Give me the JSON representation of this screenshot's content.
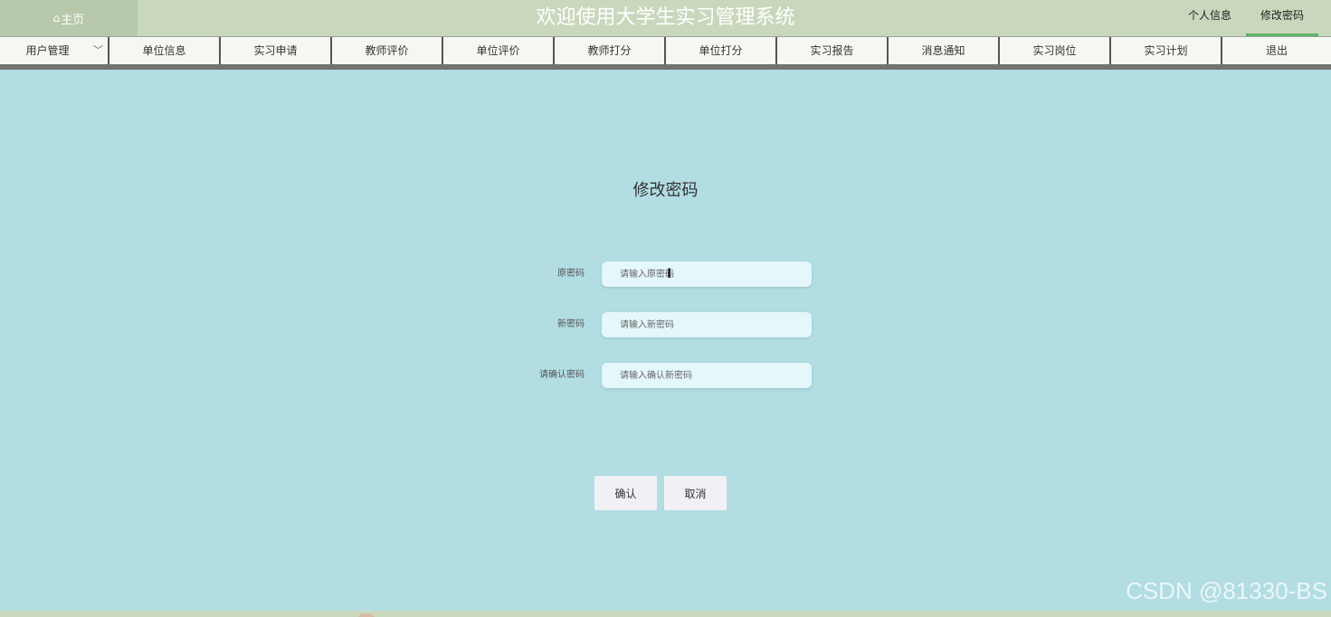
{
  "header": {
    "home_label": "主页",
    "site_title": "欢迎使用大学生实习管理系统",
    "links": [
      {
        "label": "个人信息"
      },
      {
        "label": "修改密码"
      }
    ]
  },
  "nav": {
    "items": [
      {
        "label": "用户管理"
      },
      {
        "label": "单位信息"
      },
      {
        "label": "实习申请"
      },
      {
        "label": "教师评价"
      },
      {
        "label": "单位评价"
      },
      {
        "label": "教师打分"
      },
      {
        "label": "单位打分"
      },
      {
        "label": "实习报告"
      },
      {
        "label": "消息通知"
      },
      {
        "label": "实习岗位"
      },
      {
        "label": "实习计划"
      },
      {
        "label": "退出"
      }
    ]
  },
  "form": {
    "title": "修改密码",
    "fields": [
      {
        "label": "原密码",
        "placeholder": "请输入原密码",
        "value": ""
      },
      {
        "label": "新密码",
        "placeholder": "请输入新密码",
        "value": ""
      },
      {
        "label": "请确认密码",
        "placeholder": "请输入确认新密码",
        "value": ""
      }
    ],
    "confirm_label": "确认",
    "cancel_label": "取消"
  },
  "watermark": "CSDN @81330-BS",
  "colors": {
    "header_bg": "#c9d8bd",
    "home_bg": "#b8c8ab",
    "page_bg": "#b2dde3",
    "nav_bg": "#f5f8f2",
    "active_underline": "#5db36a",
    "input_bg": "#e4f7fb"
  },
  "icons": {
    "home": "home-icon",
    "dropdown": "chevron-down-icon",
    "text_cursor": "text-cursor-icon"
  }
}
